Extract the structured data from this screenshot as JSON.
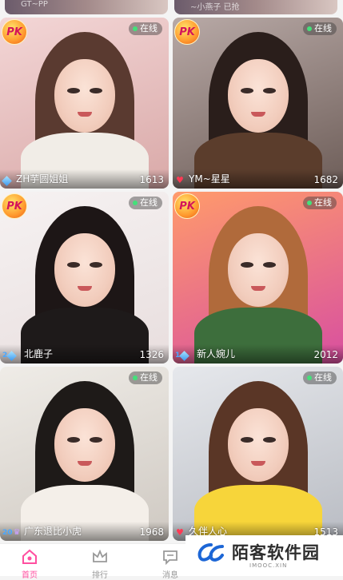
{
  "top_strip": {
    "left_text": "GT~PP",
    "right_text": "~小燕子 已抢"
  },
  "badges": {
    "pk": "PK",
    "online": "在线"
  },
  "cards": [
    {
      "name": "ZH芋圆姐姐",
      "level": "",
      "level_icon": "diamond-icon",
      "count": "1613",
      "pk": true,
      "bg": [
        "#f3d6d6",
        "#d9a9a8"
      ],
      "hair": "#5a3a30",
      "cloth": "#f1ede7"
    },
    {
      "name": "YM~星星",
      "level": "",
      "level_icon": "heart-icon",
      "count": "1682",
      "pk": true,
      "bg": [
        "#b8a9a6",
        "#6d5d58"
      ],
      "hair": "#2a1e1b",
      "cloth": "#5b3d2c"
    },
    {
      "name": "北鹿子",
      "level": "2",
      "level_icon": "diamond-icon",
      "count": "1326",
      "pk": true,
      "bg": [
        "#f6f2f2",
        "#e8dede"
      ],
      "hair": "#1d1616",
      "cloth": "#1e1a1a"
    },
    {
      "name": "新人婉儿",
      "level": "1",
      "level_icon": "diamond-icon",
      "count": "2012",
      "pk": true,
      "bg": [
        "#ff9b6b",
        "#d84fa0"
      ],
      "hair": "#b06a3b",
      "cloth": "#3d6e3c"
    },
    {
      "name": "广东退比小虎",
      "level": "20",
      "level_icon": "crown-icon",
      "count": "1968",
      "pk": false,
      "bg": [
        "#efece7",
        "#cfc9c2"
      ],
      "hair": "#1e1a18",
      "cloth": "#f4efe9"
    },
    {
      "name": "久伴人心",
      "level": "",
      "level_icon": "heart-icon",
      "count": "1513",
      "pk": false,
      "bg": [
        "#e6e8ec",
        "#b9bcc3"
      ],
      "hair": "#5a3626",
      "cloth": "#f7d53a"
    }
  ],
  "tabbar": [
    {
      "label": "首页",
      "icon": "home-icon",
      "active": true
    },
    {
      "label": "排行",
      "icon": "crown-icon",
      "active": false
    },
    {
      "label": "消息",
      "icon": "message-icon",
      "active": false
    }
  ],
  "watermark": {
    "title": "陌客软件园",
    "subtitle": "IMOOC.XIN"
  },
  "colors": {
    "accent": "#ff4fa0",
    "online": "#44e07a",
    "level_blue": "#49a7ff"
  }
}
